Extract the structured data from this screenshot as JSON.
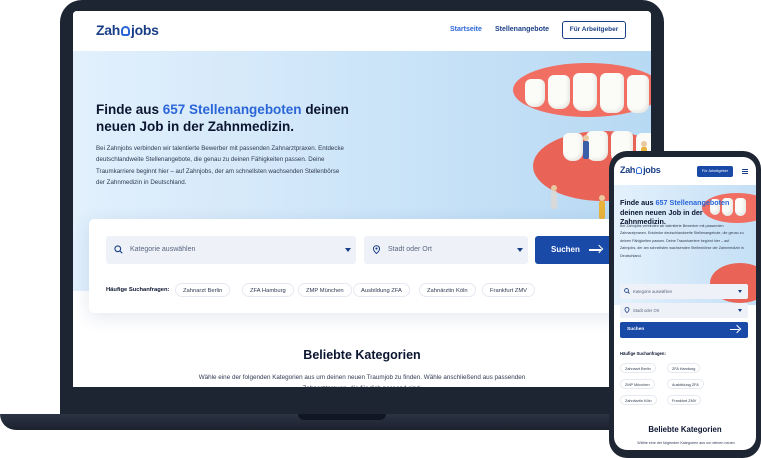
{
  "brand": {
    "logo_left": "Zah",
    "logo_right": "jobs"
  },
  "nav": {
    "links": [
      {
        "label": "Startseite"
      },
      {
        "label": "Stellenangebote"
      }
    ],
    "cta": "Für Arbeitgeber"
  },
  "hero": {
    "title_before": "Finde aus ",
    "title_highlight": "657 Stellenangeboten",
    "title_after": " deinen neuen Job in der Zahnmedizin.",
    "lead": "Bei Zahnjobs verbinden wir talentierte Bewerber mit passenden Zahnarztpraxen. Entdecke deutschlandweite Stellenangebote, die genau zu deinen Fähigkeiten passen. Deine Traumkarriere beginnt hier – auf Zahnjobs, der am schnellsten wachsenden Stellenbörse der Zahnmedizin in Deutschland."
  },
  "search": {
    "category_placeholder": "Kategorie auswählen",
    "location_placeholder": "Stadt oder Ort",
    "button": "Suchen",
    "frequent_label": "Häufige Suchanfragen:",
    "tags": [
      "Zahnarzt Berlin",
      "ZFA Hamburg",
      "ZMP München",
      "Ausbildung ZFA",
      "Zahnärztin Köln",
      "Frankfurt ZMV"
    ]
  },
  "categories": {
    "title": "Beliebte Kategorien",
    "text": "Wähle eine der folgenden Kategorien aus um deinen neuen Traumjob zu finden. Wähle anschließend aus passenden Zahnarztpraxen, die für dich passend sind."
  },
  "phone": {
    "cta": "Für Arbeitgeber",
    "section_text": "Wähle eine der folgenden Kategorien aus um deinen neuen"
  },
  "colors": {
    "brand_blue": "#1a4aa8",
    "highlight": "#2b66d8",
    "device_frame": "#1d2432"
  }
}
